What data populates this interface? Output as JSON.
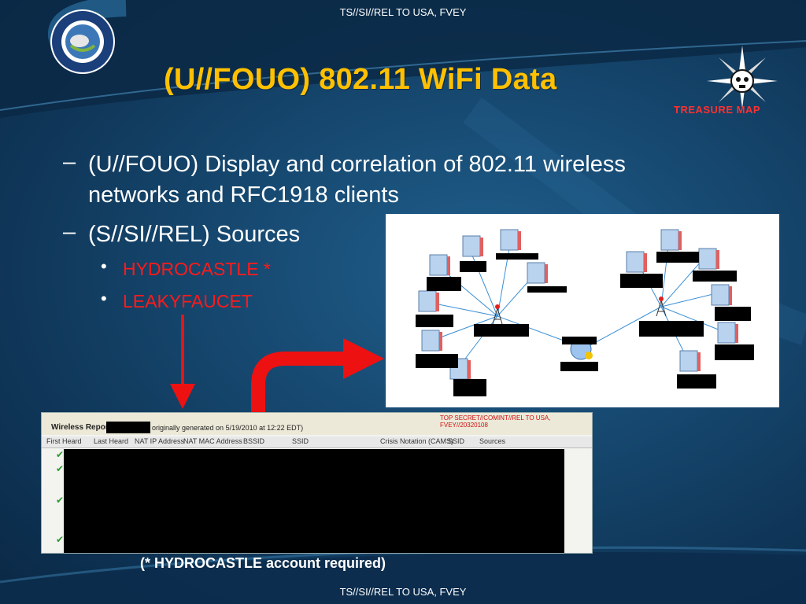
{
  "classification": {
    "top": "TS//SI//REL TO USA, FVEY",
    "bottom": "TS//SI//REL TO USA, FVEY"
  },
  "title": "(U//FOUO)  802.11 WiFi Data",
  "bullets": {
    "b1_line1": "(U//FOUO)  Display and correlation of 802.11 wireless",
    "b1_line2": "networks and RFC1918 clients",
    "b2": "(S//SI//REL)  Sources",
    "sub1": "HYDROCASTLE *",
    "sub2": "LEAKYFAUCET"
  },
  "logo": {
    "treasure_map_label": "TREASURE MAP",
    "seal_icon": "agency-seal-icon",
    "compass_icon": "skull-compass-icon"
  },
  "report": {
    "title_prefix": "Wireless Report:",
    "title_suffix": "originally generated on 5/19/2010 at 12:22 EDT)",
    "classification_banner": "TOP SECRET//COMINT//REL TO USA, FVEY//20320108",
    "columns": [
      "First Heard",
      "Last Heard",
      "NAT IP Address",
      "NAT MAC Address",
      "BSSID",
      "SSID",
      "Crisis Notation (CAMS)",
      "SSID",
      "Sources"
    ]
  },
  "footnote": "(* HYDROCASTLE account required)",
  "colors": {
    "title": "#ffc000",
    "sources": "#ff1a1a",
    "arrow": "#ee1111"
  }
}
